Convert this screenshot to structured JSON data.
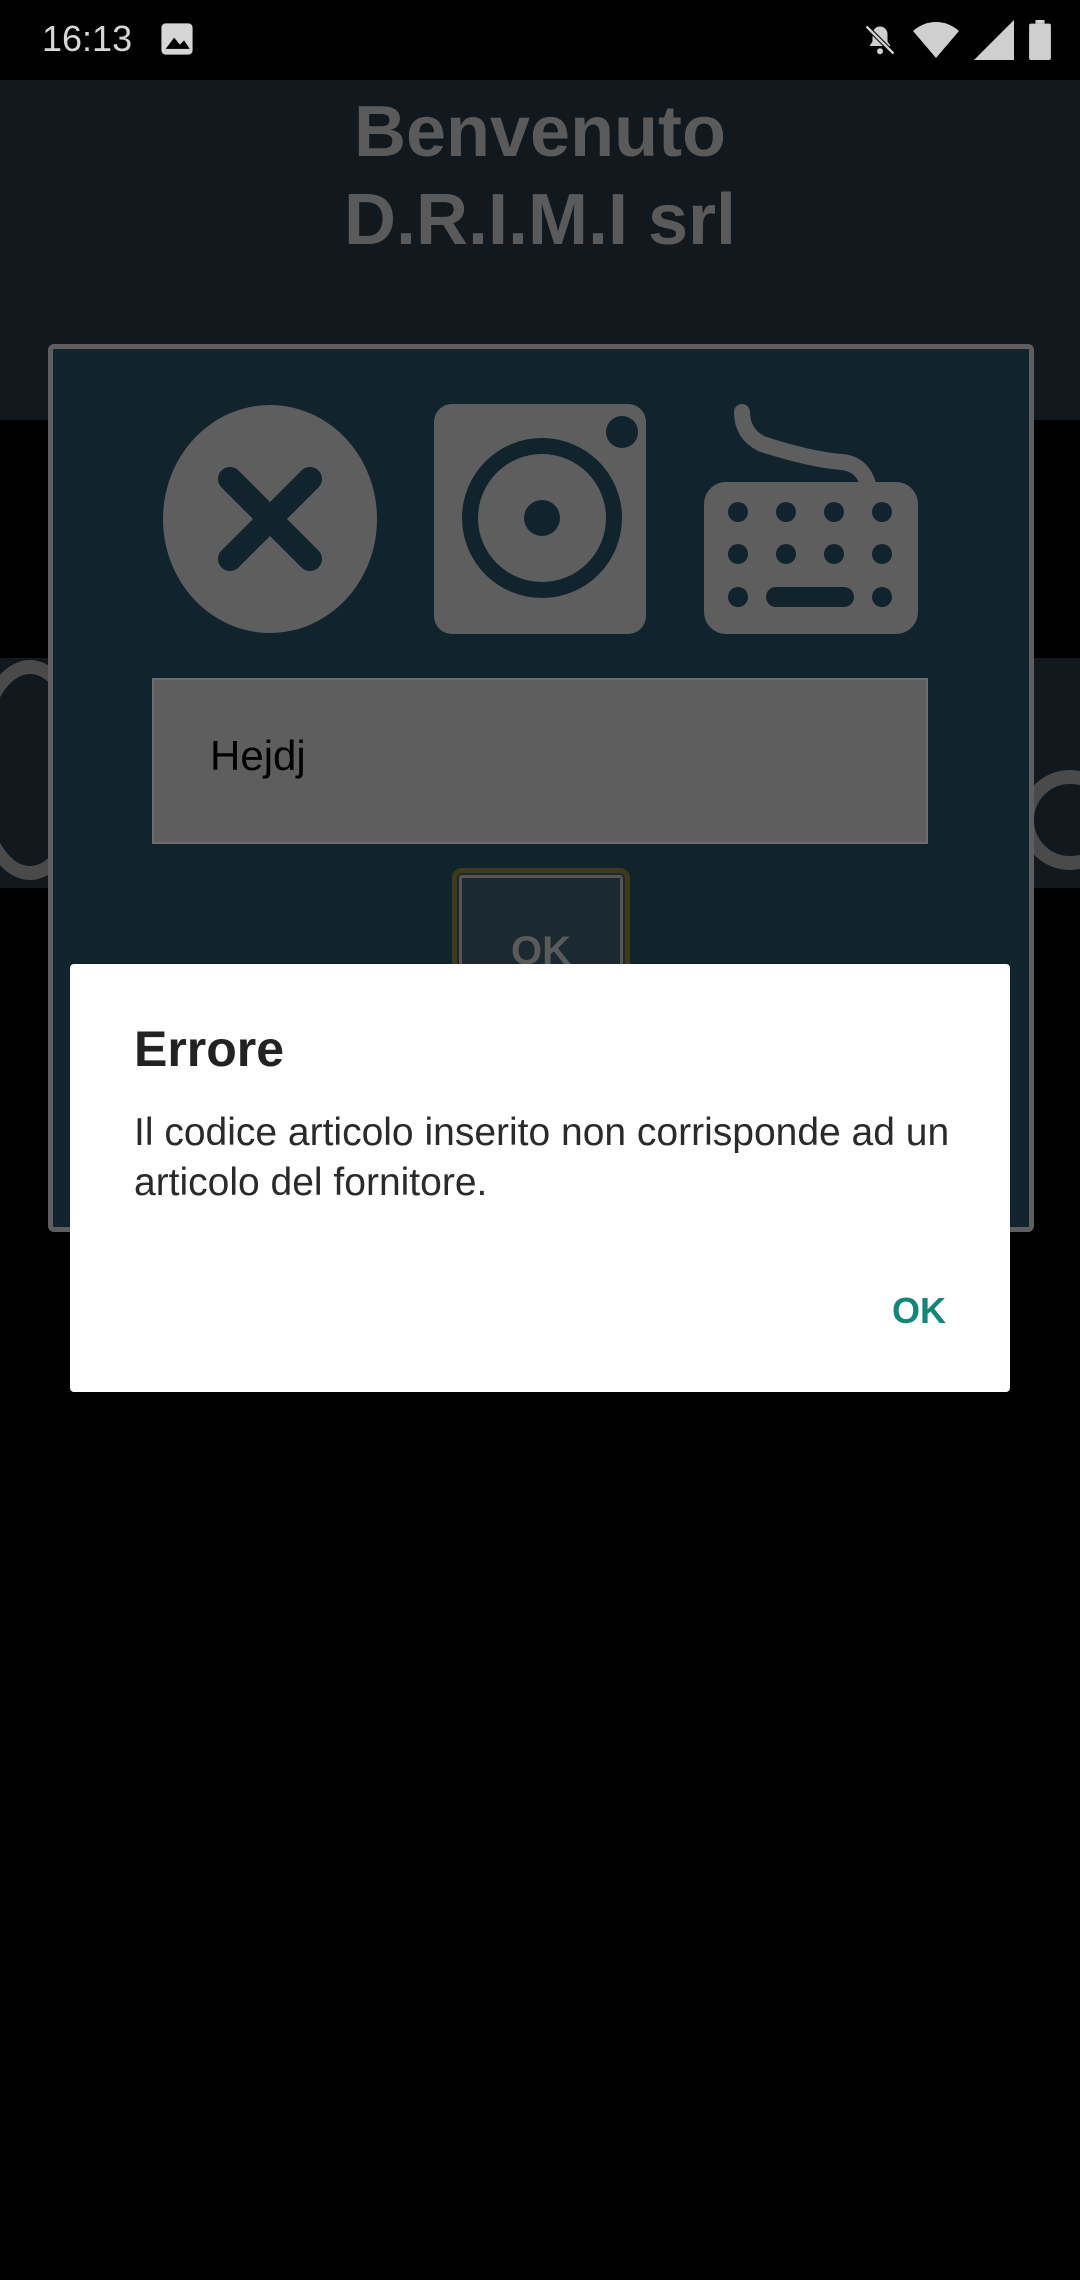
{
  "status_bar": {
    "time": "16:13",
    "icons": [
      "gallery-icon",
      "mute-bell-icon",
      "wifi-icon",
      "signal-icon",
      "battery-icon"
    ]
  },
  "app": {
    "title_line1": "Benvenuto",
    "title_line2": "D.R.I.M.I srl",
    "panel": {
      "icons": [
        "close-icon",
        "camera-icon",
        "keyboard-icon"
      ],
      "input_value": "Hejdj",
      "ok_label": "OK"
    }
  },
  "dialog": {
    "title": "Errore",
    "message": "Il codice articolo inserito non corrisponde ad un articolo del fornitore.",
    "ok_label": "OK",
    "accent_color": "#14857a"
  }
}
